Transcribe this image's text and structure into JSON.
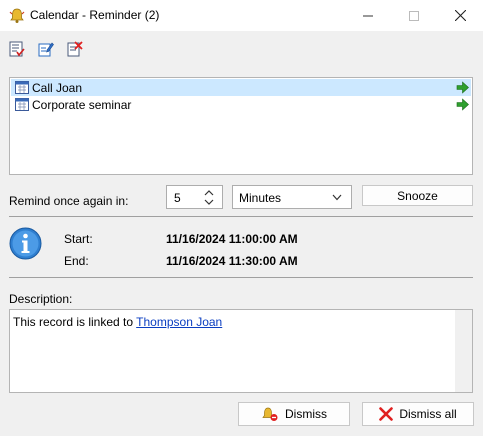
{
  "window": {
    "title": "Calendar - Reminder (2)",
    "app_icon": "calendar-bell-icon",
    "controls": [
      "minimize-icon",
      "maximize-icon",
      "close-icon"
    ]
  },
  "toolbar": {
    "buttons": [
      "select-all-icon",
      "edit-record-icon",
      "delete-record-icon"
    ]
  },
  "reminders": [
    {
      "label": "Call Joan",
      "selected": true,
      "icon": "calendar-icon",
      "action_icon": "go-arrow-icon"
    },
    {
      "label": "Corporate seminar",
      "selected": false,
      "icon": "calendar-icon",
      "action_icon": "go-arrow-icon"
    }
  ],
  "remind": {
    "label": "Remind once again in:",
    "amount": "5",
    "unit": "Minutes",
    "snooze_label": "Snooze"
  },
  "details": {
    "icon": "info-icon",
    "start_label": "Start:",
    "start_value": "11/16/2024 11:00:00 AM",
    "end_label": "End:",
    "end_value": "11/16/2024 11:30:00 AM"
  },
  "description": {
    "label": "Description:",
    "text": "This record is linked to",
    "link": "Thompson Joan"
  },
  "footer": {
    "dismiss_label": "Dismiss",
    "dismiss_all_label": "Dismiss all"
  },
  "colors": {
    "selection": "#cce8ff",
    "link": "#0b3ec1",
    "go_arrow": "#2ea02e",
    "info_blue": "#2f7fd0",
    "dismiss_red": "#e02020"
  }
}
